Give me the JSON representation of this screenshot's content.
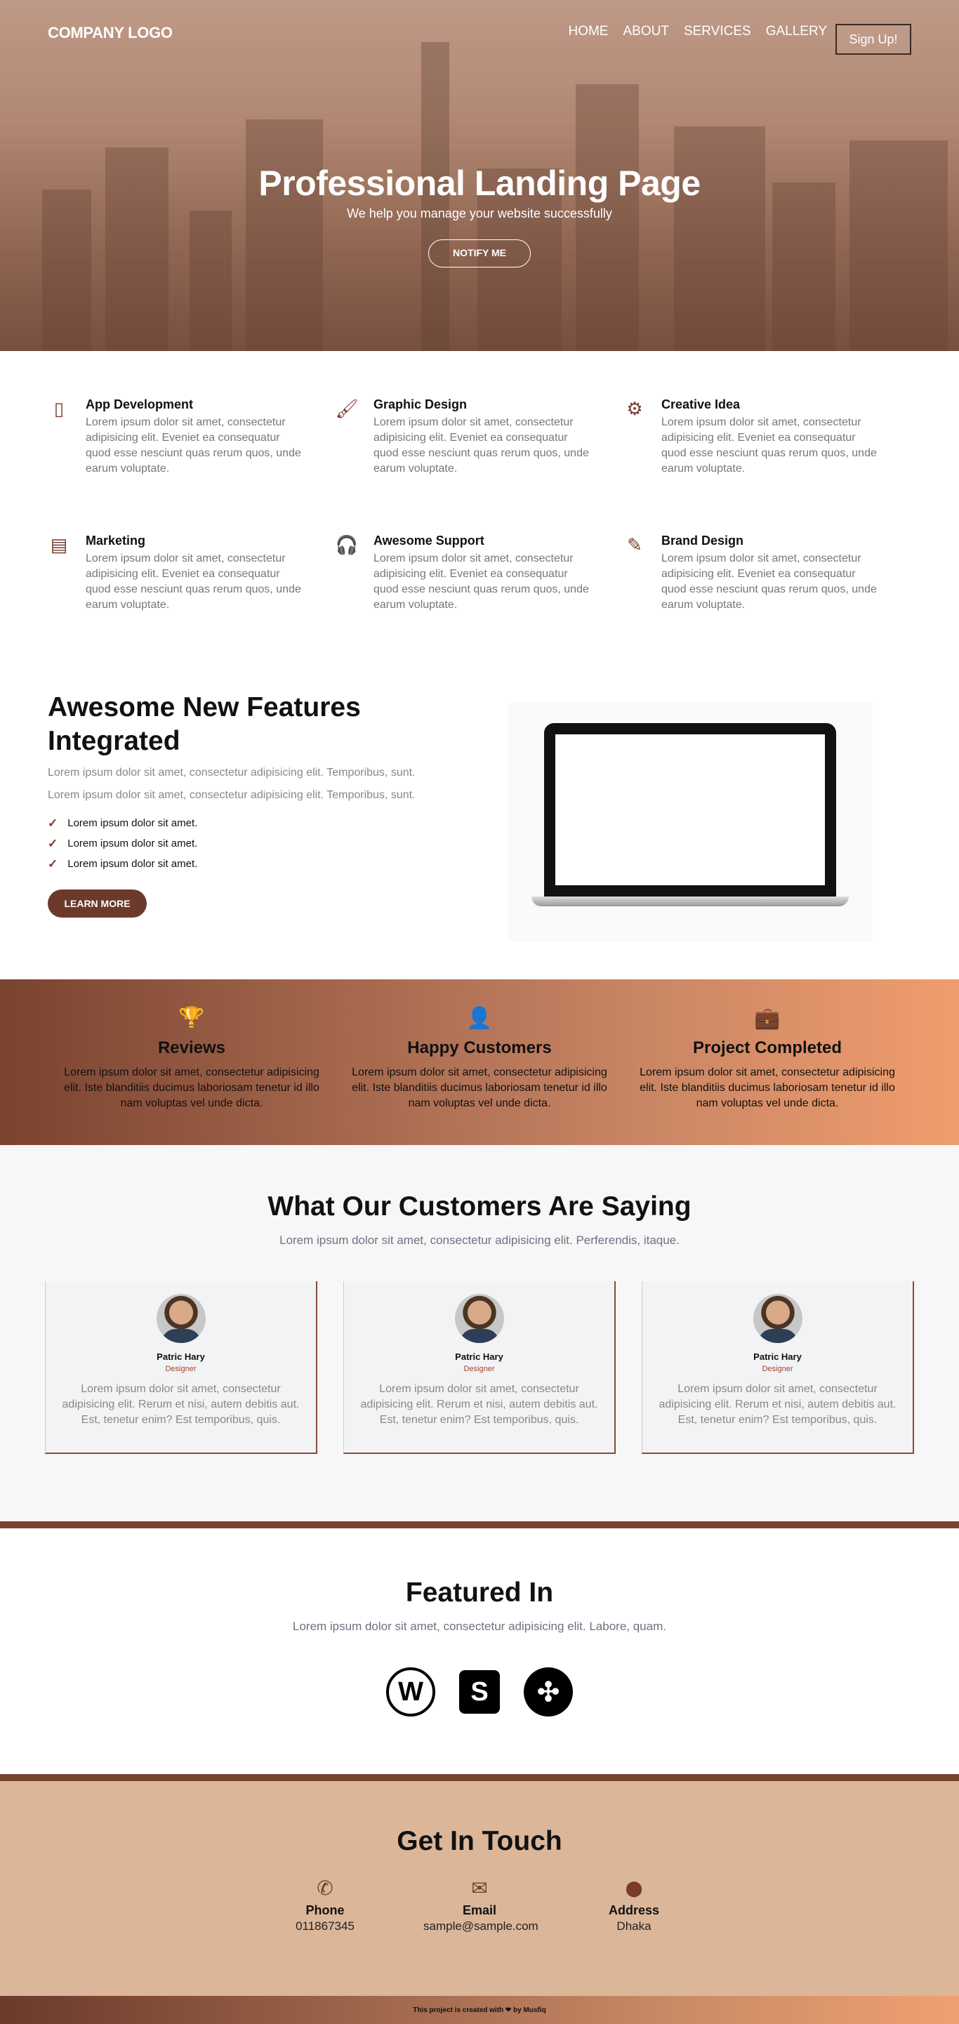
{
  "nav": {
    "logo": "COMPANY LOGO",
    "items": [
      "HOME",
      "ABOUT",
      "SERVICES",
      "GALLERY"
    ],
    "signup": "Sign Up!"
  },
  "hero": {
    "title": "Professional Landing Page",
    "subtitle": "We help you manage your website successfully",
    "button": "NOTIFY ME"
  },
  "services": [
    {
      "icon": "mobile-icon",
      "glyph": "▯",
      "title": "App Development",
      "text": "Lorem ipsum dolor sit amet, consectetur adipisicing elit. Eveniet ea consequatur quod esse nesciunt quas rerum quos, unde earum voluptate."
    },
    {
      "icon": "paint-brush-icon",
      "glyph": "🖌",
      "title": "Graphic Design",
      "text": "Lorem ipsum dolor sit amet, consectetur adipisicing elit. Eveniet ea consequatur quod esse nesciunt quas rerum quos, unde earum voluptate."
    },
    {
      "icon": "gears-icon",
      "glyph": "⚙",
      "title": "Creative Idea",
      "text": "Lorem ipsum dolor sit amet, consectetur adipisicing elit. Eveniet ea consequatur quod esse nesciunt quas rerum quos, unde earum voluptate."
    },
    {
      "icon": "file-icon",
      "glyph": "▤",
      "title": "Marketing",
      "text": "Lorem ipsum dolor sit amet, consectetur adipisicing elit. Eveniet ea consequatur quod esse nesciunt quas rerum quos, unde earum voluptate."
    },
    {
      "icon": "headphones-icon",
      "glyph": "🎧",
      "title": "Awesome Support",
      "text": "Lorem ipsum dolor sit amet, consectetur adipisicing elit. Eveniet ea consequatur quod esse nesciunt quas rerum quos, unde earum voluptate."
    },
    {
      "icon": "pencil-ruler-icon",
      "glyph": "✎",
      "title": "Brand Design",
      "text": "Lorem ipsum dolor sit amet, consectetur adipisicing elit. Eveniet ea consequatur quod esse nesciunt quas rerum quos, unde earum voluptate."
    }
  ],
  "features": {
    "title": "Awesome New Features Integrated",
    "para1": "Lorem ipsum dolor sit amet, consectetur adipisicing elit. Temporibus, sunt.",
    "para2": "Lorem ipsum dolor sit amet, consectetur adipisicing elit. Temporibus, sunt.",
    "checks": [
      "Lorem ipsum dolor sit amet.",
      "Lorem ipsum dolor sit amet.",
      "Lorem ipsum dolor sit amet."
    ],
    "button": "LEARN MORE"
  },
  "stats": [
    {
      "icon": "trophy-icon",
      "glyph": "🏆",
      "title": "Reviews",
      "text": "Lorem ipsum dolor sit amet, consectetur adipisicing elit. Iste blanditiis ducimus laboriosam tenetur id illo nam voluptas vel unde dicta."
    },
    {
      "icon": "user-icon",
      "glyph": "👤",
      "title": "Happy Customers",
      "text": "Lorem ipsum dolor sit amet, consectetur adipisicing elit. Iste blanditiis ducimus laboriosam tenetur id illo nam voluptas vel unde dicta."
    },
    {
      "icon": "briefcase-icon",
      "glyph": "💼",
      "title": "Project Completed",
      "text": "Lorem ipsum dolor sit amet, consectetur adipisicing elit. Iste blanditiis ducimus laboriosam tenetur id illo nam voluptas vel unde dicta."
    }
  ],
  "testimonials": {
    "title": "What Our Customers Are Saying",
    "subtitle": "Lorem ipsum dolor sit amet, consectetur adipisicing elit. Perferendis, itaque.",
    "cards": [
      {
        "name": "Patric Hary",
        "role": "Designer",
        "text": "Lorem ipsum dolor sit amet, consectetur adipisicing elit. Rerum et nisi, autem debitis aut. Est, tenetur enim? Est temporibus, quis."
      },
      {
        "name": "Patric Hary",
        "role": "Designer",
        "text": "Lorem ipsum dolor sit amet, consectetur adipisicing elit. Rerum et nisi, autem debitis aut. Est, tenetur enim? Est temporibus, quis."
      },
      {
        "name": "Patric Hary",
        "role": "Designer",
        "text": "Lorem ipsum dolor sit amet, consectetur adipisicing elit. Rerum et nisi, autem debitis aut. Est, tenetur enim? Est temporibus, quis."
      }
    ]
  },
  "featured": {
    "title": "Featured In",
    "subtitle": "Lorem ipsum dolor sit amet, consectetur adipisicing elit. Labore, quam.",
    "logos": [
      {
        "icon": "wordpress-icon",
        "glyph": "W"
      },
      {
        "icon": "shopify-icon",
        "glyph": "S"
      },
      {
        "icon": "joomla-icon",
        "glyph": "✣"
      }
    ]
  },
  "contact": {
    "title": "Get In Touch",
    "items": [
      {
        "icon": "phone-icon",
        "glyph": "✆",
        "label": "Phone",
        "value": "011867345"
      },
      {
        "icon": "envelope-icon",
        "glyph": "✉",
        "label": "Email",
        "value": "sample@sample.com"
      },
      {
        "icon": "map-marker-icon",
        "glyph": "⬤",
        "label": "Address",
        "value": "Dhaka"
      }
    ]
  },
  "footer": {
    "text_before": "This project is created with",
    "heart": "❤",
    "text_after": "by Musfiq"
  },
  "colors": {
    "brand": "#7a3b2a",
    "accent": "#f09d6d",
    "contact_bg": "#dbb699"
  }
}
